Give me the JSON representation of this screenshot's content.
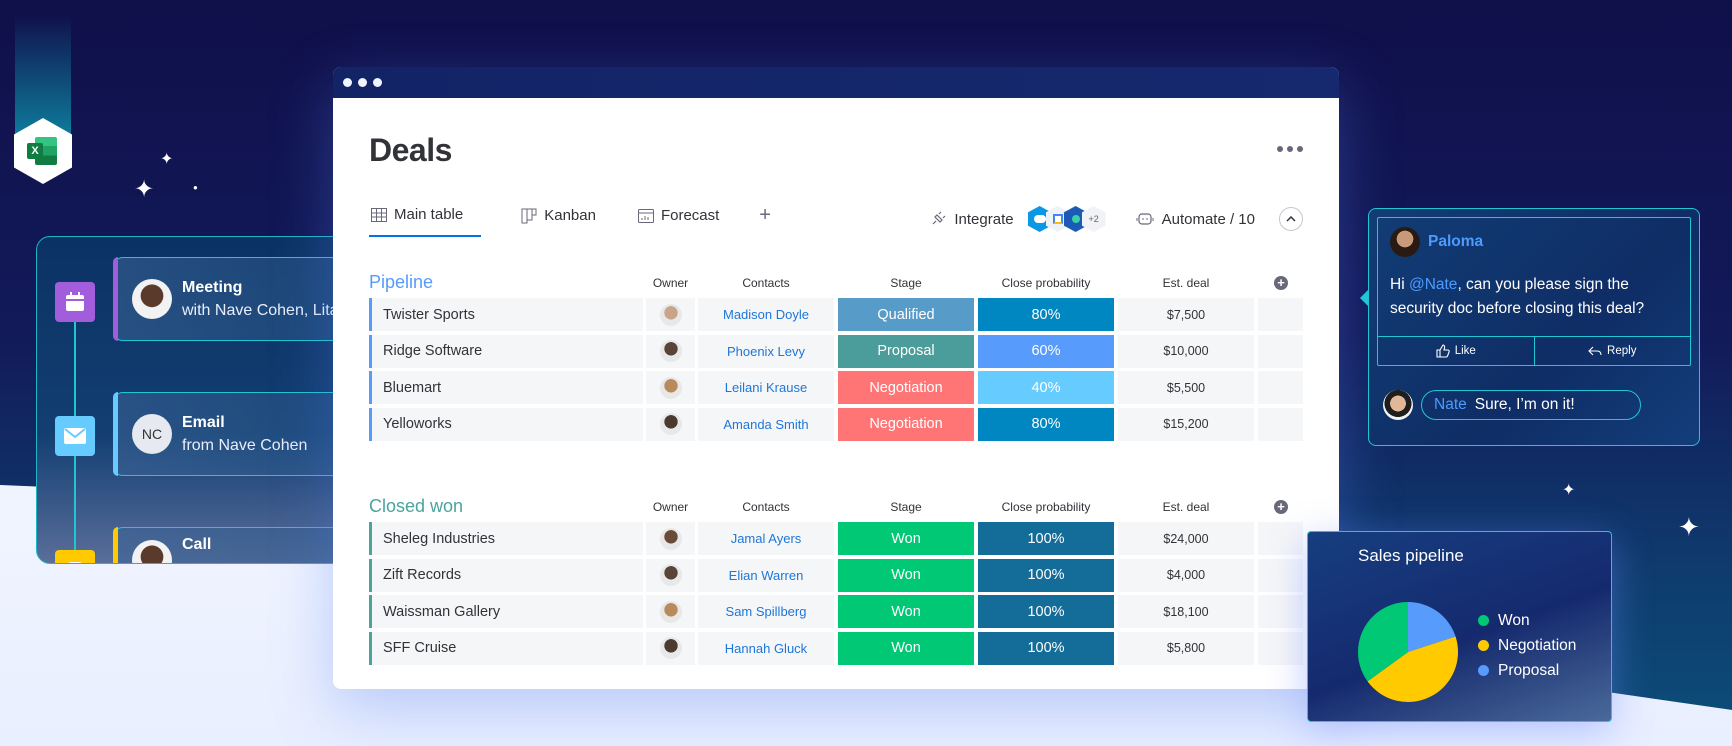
{
  "app": {
    "window_controls": [
      "dot",
      "dot",
      "dot"
    ]
  },
  "board": {
    "title": "Deals",
    "more_icon": "ellipsis-icon",
    "tabs": [
      {
        "label": "Main table",
        "icon": "table-icon",
        "active": true
      },
      {
        "label": "Kanban",
        "icon": "kanban-icon",
        "active": false
      },
      {
        "label": "Forecast",
        "icon": "chart-icon",
        "active": false
      }
    ],
    "add_tab_label": "+",
    "integrate_label": "Integrate",
    "integrations_more": "+2",
    "automate_label": "Automate / 10",
    "collapse_icon": "chevron-up-icon"
  },
  "columns": {
    "owner": "Owner",
    "contacts": "Contacts",
    "stage": "Stage",
    "probability": "Close probability",
    "deal": "Est. deal",
    "add": "+"
  },
  "groups": [
    {
      "title": "Pipeline",
      "color": "#579bfc",
      "rows": [
        {
          "name": "Twister Sports",
          "contact": "Madison Doyle",
          "stage": "Qualified",
          "stage_color": "#579bc8",
          "probability": "80%",
          "prob_color": "#0086c0",
          "deal": "$7,500",
          "avatar_color": "#c8a48a"
        },
        {
          "name": "Ridge Software",
          "contact": "Phoenix Levy",
          "stage": "Proposal",
          "stage_color": "#4a9d9a",
          "probability": "60%",
          "prob_color": "#579bfc",
          "deal": "$10,000",
          "avatar_color": "#5a4438"
        },
        {
          "name": "Bluemart",
          "contact": "Leilani Krause",
          "stage": "Negotiation",
          "stage_color": "#ff7575",
          "probability": "40%",
          "prob_color": "#66ccff",
          "deal": "$5,500",
          "avatar_color": "#b98a5a"
        },
        {
          "name": "Yelloworks",
          "contact": "Amanda Smith",
          "stage": "Negotiation",
          "stage_color": "#ff7575",
          "probability": "80%",
          "prob_color": "#0086c0",
          "deal": "$15,200",
          "avatar_color": "#4a3a30"
        }
      ]
    },
    {
      "title": "Closed won",
      "color": "#4aa39d",
      "rows": [
        {
          "name": "Sheleg Industries",
          "contact": "Jamal Ayers",
          "stage": "Won",
          "stage_color": "#00c875",
          "probability": "100%",
          "prob_color": "#146c99",
          "deal": "$24,000",
          "avatar_color": "#6a4a38"
        },
        {
          "name": "Zift Records",
          "contact": "Elian Warren",
          "stage": "Won",
          "stage_color": "#00c875",
          "probability": "100%",
          "prob_color": "#146c99",
          "deal": "$4,000",
          "avatar_color": "#5a4438"
        },
        {
          "name": "Waissman Gallery",
          "contact": "Sam Spillberg",
          "stage": "Won",
          "stage_color": "#00c875",
          "probability": "100%",
          "prob_color": "#146c99",
          "deal": "$18,100",
          "avatar_color": "#b98a5a"
        },
        {
          "name": "SFF Cruise",
          "contact": "Hannah Gluck",
          "stage": "Won",
          "stage_color": "#00c875",
          "probability": "100%",
          "prob_color": "#146c99",
          "deal": "$5,800",
          "avatar_color": "#4a3a30"
        }
      ]
    }
  ],
  "activity": {
    "items": [
      {
        "type": "Meeting",
        "subtitle": "with Nave Cohen, Lita",
        "icon": "calendar-icon",
        "icon_color": "#a25ddc",
        "bar_color": "#a25ddc",
        "avatar": "photo",
        "avatar_color": "#5a3a2a"
      },
      {
        "type": "Email",
        "subtitle": "from Nave Cohen",
        "icon": "mail-icon",
        "icon_color": "#66ccff",
        "bar_color": "#66ccff",
        "avatar": "NC",
        "avatar_color": "#e6e9ef"
      },
      {
        "type": "Call",
        "subtitle": "",
        "icon": "phone-icon",
        "icon_color": "#ffcb00",
        "bar_color": "#ffcb00",
        "avatar": "photo",
        "avatar_color": "#5a3a2a"
      }
    ]
  },
  "comments": {
    "author": "Paloma",
    "mention": "@Nate",
    "text_before": "Hi ",
    "text_after": ", can you please sign the security doc before closing this deal?",
    "like_label": "Like",
    "reply_label": "Reply",
    "reply_author": "Nate",
    "reply_text": "Sure, I’m on it!"
  },
  "chart_data": {
    "type": "pie",
    "title": "Sales pipeline",
    "categories": [
      "Proposal",
      "Negotiation",
      "Won"
    ],
    "values": [
      20,
      45,
      35
    ],
    "colors": [
      "#579bfc",
      "#ffcb00",
      "#00c875"
    ],
    "legend": [
      {
        "label": "Won",
        "color": "#00c875"
      },
      {
        "label": "Negotiation",
        "color": "#ffcb00"
      },
      {
        "label": "Proposal",
        "color": "#579bfc"
      }
    ],
    "legend_position": "right"
  }
}
